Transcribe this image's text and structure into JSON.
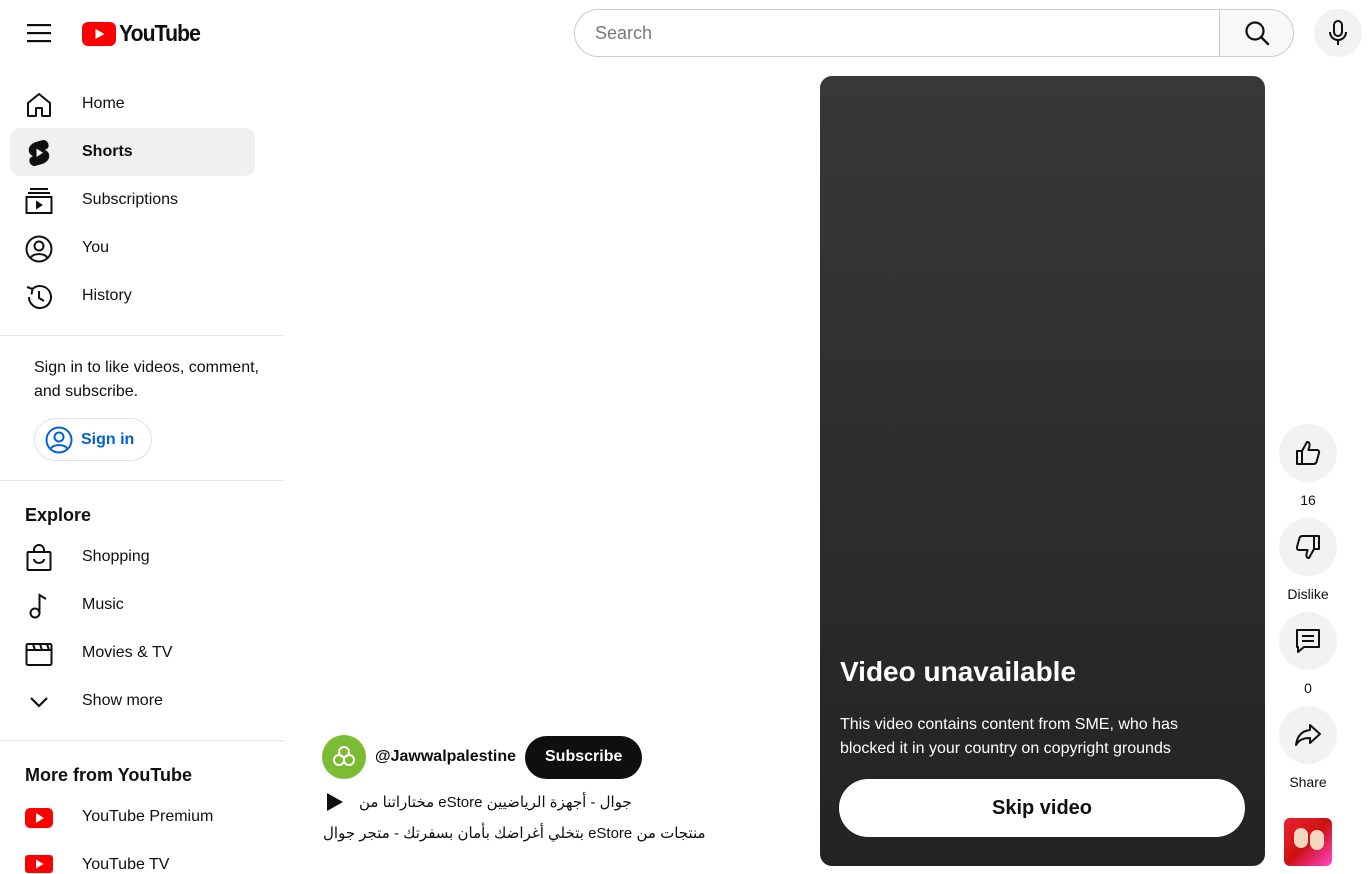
{
  "header": {
    "logo_text": "YouTube",
    "search_placeholder": "Search"
  },
  "sidebar": {
    "main_items": [
      {
        "label": "Home",
        "icon": "home-icon"
      },
      {
        "label": "Shorts",
        "icon": "shorts-icon",
        "active": true
      },
      {
        "label": "Subscriptions",
        "icon": "subscriptions-icon"
      },
      {
        "label": "You",
        "icon": "you-icon"
      },
      {
        "label": "History",
        "icon": "history-icon"
      }
    ],
    "signin_prompt": "Sign in to like videos, comment, and subscribe.",
    "signin_label": "Sign in",
    "explore_title": "Explore",
    "explore_items": [
      {
        "label": "Shopping",
        "icon": "shopping-bag-icon"
      },
      {
        "label": "Music",
        "icon": "music-note-icon"
      },
      {
        "label": "Movies & TV",
        "icon": "clapperboard-icon"
      },
      {
        "label": "Show more",
        "icon": "chevron-down-icon"
      }
    ],
    "more_title": "More from YouTube",
    "more_items": [
      {
        "label": "YouTube Premium",
        "icon": "youtube-premium-icon"
      },
      {
        "label": "YouTube TV",
        "icon": "youtube-tv-icon"
      }
    ]
  },
  "player": {
    "title": "Video unavailable",
    "message": "This video contains content from SME, who has blocked it in your country on copyright grounds",
    "skip_label": "Skip video"
  },
  "short_info": {
    "channel_handle": "@Jawwalpalestine",
    "subscribe_label": "Subscribe",
    "track": "جوال - أجهزة الرياضيين eStore مختاراتنا من",
    "description": "منتجات من eStore بتخلي أغراضك بأمان بسفرتك - متجر جوال"
  },
  "actions": {
    "like_count": "16",
    "dislike_label": "Dislike",
    "comment_count": "0",
    "share_label": "Share"
  },
  "colors": {
    "brand_red": "#ff0000",
    "link_blue": "#065fd4",
    "channel_avatar": "#7cbc32"
  }
}
